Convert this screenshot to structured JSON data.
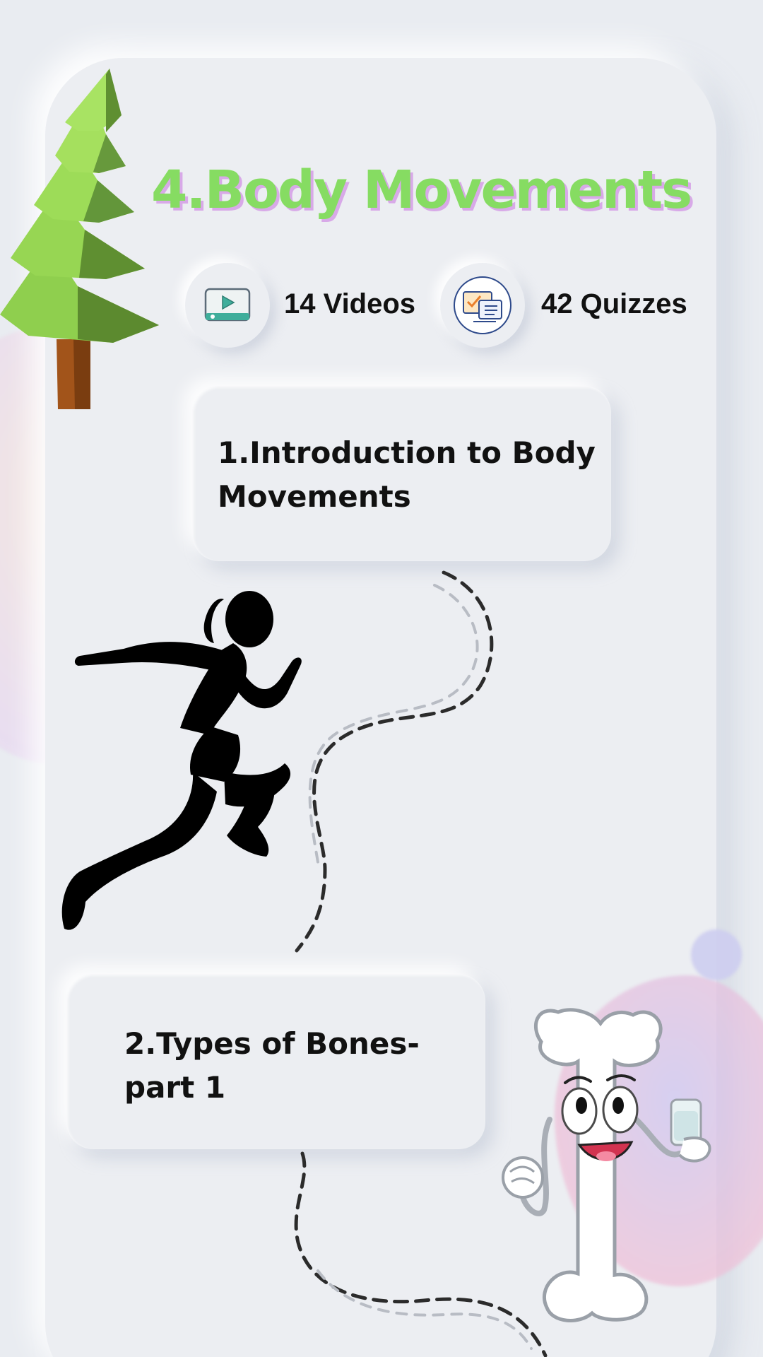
{
  "unit": {
    "title": "4.Body Movements",
    "title_color": "#86dc62",
    "title_shadow_color": "#d8a9e8"
  },
  "stats": {
    "videos": {
      "label": "14 Videos",
      "icon": "video-play-icon"
    },
    "quizzes": {
      "label": "42 Quizzes",
      "icon": "quiz-checklist-icon"
    }
  },
  "lessons": [
    {
      "title": "1.Introduction to Body Movements"
    },
    {
      "title": "2.Types of Bones-part 1"
    }
  ],
  "illustrations": {
    "tree": "pine-tree-illustration",
    "runner": "running-woman-silhouette",
    "bone": "bone-mascot-illustration"
  },
  "colors": {
    "background": "#e9ecf1",
    "path_dark": "#2b2b2b",
    "path_light": "#b8bcc4"
  }
}
